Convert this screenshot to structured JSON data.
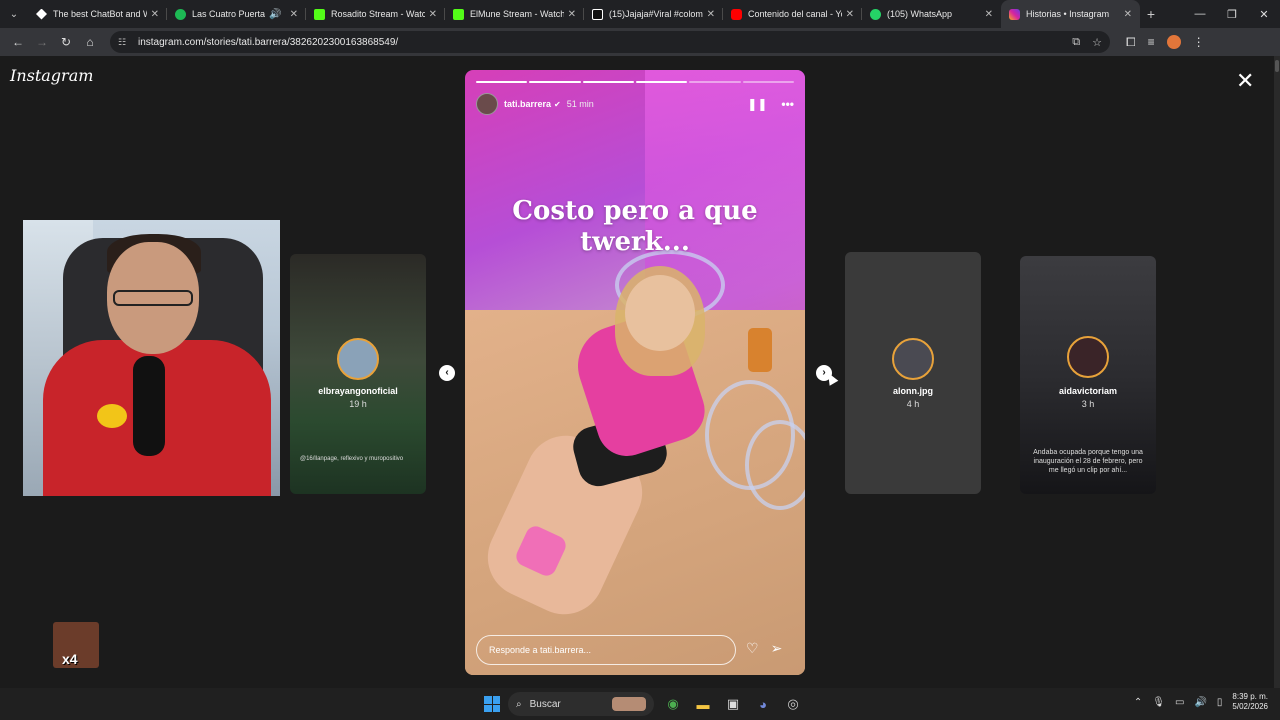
{
  "browser": {
    "tabs": [
      {
        "label": "The best ChatBot and Wi",
        "favicon_color": "#ffffff",
        "active": false
      },
      {
        "label": "Las Cuatro Puertas - L",
        "favicon_color": "#1db954",
        "active": false,
        "audio": true
      },
      {
        "label": "Rosadito Stream - Watch",
        "favicon_color": "#53fc18",
        "active": false
      },
      {
        "label": "ElMune Stream - Watch L",
        "favicon_color": "#53fc18",
        "active": false
      },
      {
        "label": "(15)Jajaja#Viral #colombi",
        "favicon_color": "#ffffff",
        "active": false
      },
      {
        "label": "Contenido del canal - You",
        "favicon_color": "#ff0000",
        "active": false
      },
      {
        "label": "(105) WhatsApp",
        "favicon_color": "#25d366",
        "active": false
      },
      {
        "label": "Historias • Instagram",
        "favicon_color": "#d6249f",
        "active": true
      }
    ],
    "url": "instagram.com/stories/tati.barrera/3826202300163868549/"
  },
  "page": {
    "logo": "Instagram",
    "close_icon": "close-icon"
  },
  "main_story": {
    "username": "tati.barrera",
    "time": "51 min",
    "overlay_text_line1": "Costo pero a que",
    "overlay_text_line2": "twerk...",
    "reply_placeholder": "Responde a tati.barrera...",
    "progress_segments_done": 4,
    "progress_segments_total": 6
  },
  "side_stories": [
    {
      "username": "elbrayangonoficial",
      "time": "19 h",
      "caption": "@16/llanpage, reflexivo y muropositivo"
    },
    {
      "username": "alonn.jpg",
      "time": "4 h",
      "caption": ""
    },
    {
      "username": "aidavictoriam",
      "time": "3 h",
      "caption": "Andaba ocupada porque tengo una inauguración el 28 de febrero, pero me llegó un clip por ahí..."
    }
  ],
  "emote": {
    "badge": "x4"
  },
  "taskbar": {
    "search_label": "Buscar",
    "time": "8:39 p. m.",
    "date": "5/02/2026"
  },
  "colors": {
    "instagram_accent": "#d6249f",
    "story_ring": "#e8a23a"
  }
}
